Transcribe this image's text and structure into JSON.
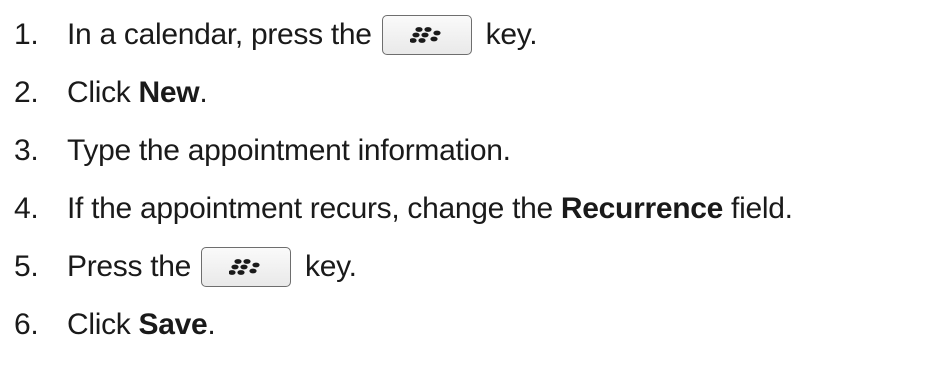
{
  "steps": [
    {
      "number": "1.",
      "text_before": "In a calendar, press the",
      "key_icon": "blackberry-menu-key-icon",
      "text_after": "key."
    },
    {
      "number": "2.",
      "text_before": "Click ",
      "bold": "New",
      "text_after": "."
    },
    {
      "number": "3.",
      "text": "Type the appointment information."
    },
    {
      "number": "4.",
      "text_before": "If the appointment recurs, change the ",
      "bold": "Recurrence",
      "text_after": " field."
    },
    {
      "number": "5.",
      "text_before": "Press the",
      "key_icon": "blackberry-menu-key-icon",
      "text_after": "key."
    },
    {
      "number": "6.",
      "text_before": "Click ",
      "bold": "Save",
      "text_after": "."
    }
  ]
}
